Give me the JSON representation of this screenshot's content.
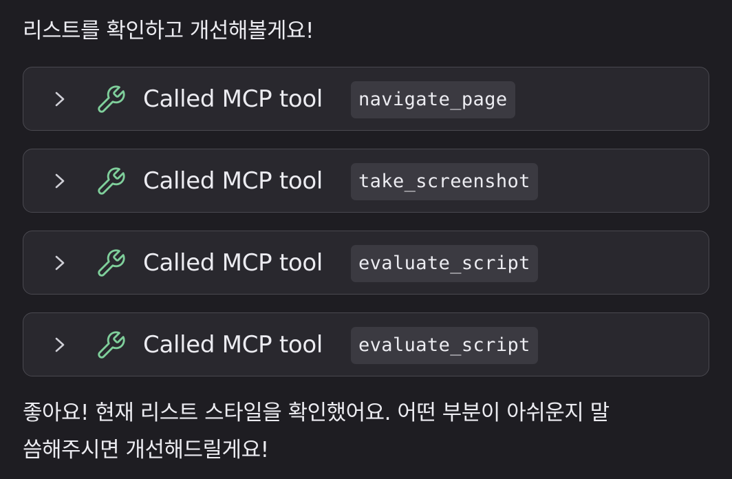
{
  "messages": {
    "intro": "리스트를 확인하고 개선해볼게요!",
    "outro_line1": "좋아요! 현재 리스트 스타일을 확인했어요. 어떤 부분이 아쉬운지 말",
    "outro_line2": "씀해주시면 개선해드릴게요!"
  },
  "tool_calls": [
    {
      "label": "Called MCP tool",
      "tool": "navigate_page"
    },
    {
      "label": "Called MCP tool",
      "tool": "take_screenshot"
    },
    {
      "label": "Called MCP tool",
      "tool": "evaluate_script"
    },
    {
      "label": "Called MCP tool",
      "tool": "evaluate_script"
    }
  ],
  "icons": {
    "expand": "chevron-right-icon",
    "tool": "wrench-icon"
  },
  "colors": {
    "background": "#1e1d22",
    "card": "#29282e",
    "card_border": "#4a4950",
    "code_bg": "#3b3a41",
    "wrench": "#7fcf9b",
    "text": "#ececf1"
  }
}
